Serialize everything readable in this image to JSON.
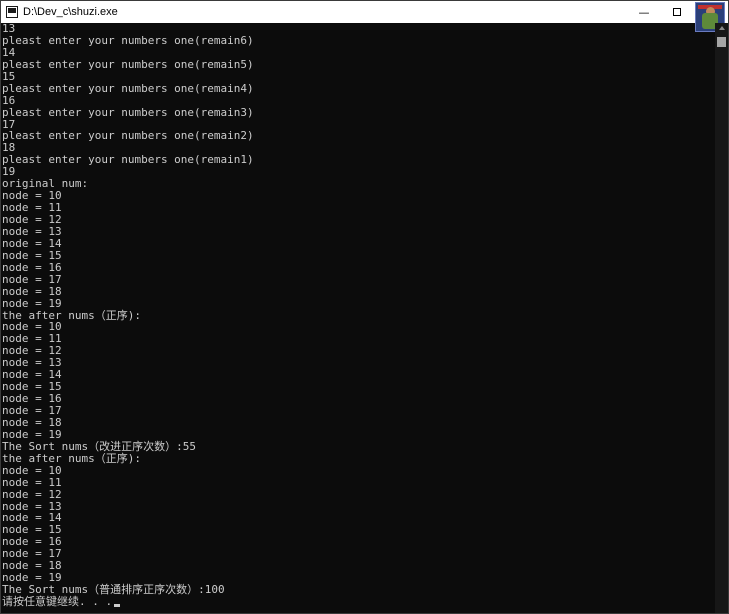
{
  "window": {
    "title": "D:\\Dev_c\\shuzi.exe",
    "minimize_symbol": "—",
    "titlebar_color": "#ffffff",
    "console_bg": "#0c0c0c",
    "console_fg": "#cccccc"
  },
  "console": {
    "lines": [
      "13",
      "pleast enter your numbers one(remain6)",
      "14",
      "pleast enter your numbers one(remain5)",
      "15",
      "pleast enter your numbers one(remain4)",
      "16",
      "pleast enter your numbers one(remain3)",
      "17",
      "pleast enter your numbers one(remain2)",
      "18",
      "pleast enter your numbers one(remain1)",
      "19",
      "original num:",
      "node = 10",
      "node = 11",
      "node = 12",
      "node = 13",
      "node = 14",
      "node = 15",
      "node = 16",
      "node = 17",
      "node = 18",
      "node = 19",
      "the after nums（正序):",
      "node = 10",
      "node = 11",
      "node = 12",
      "node = 13",
      "node = 14",
      "node = 15",
      "node = 16",
      "node = 17",
      "node = 18",
      "node = 19",
      "The Sort nums（改进正序次数）:55",
      "the after nums（正序):",
      "node = 10",
      "node = 11",
      "node = 12",
      "node = 13",
      "node = 14",
      "node = 15",
      "node = 16",
      "node = 17",
      "node = 18",
      "node = 19",
      "The Sort nums（普通排序正序次数）:100",
      "请按任意键继续. . ."
    ]
  }
}
